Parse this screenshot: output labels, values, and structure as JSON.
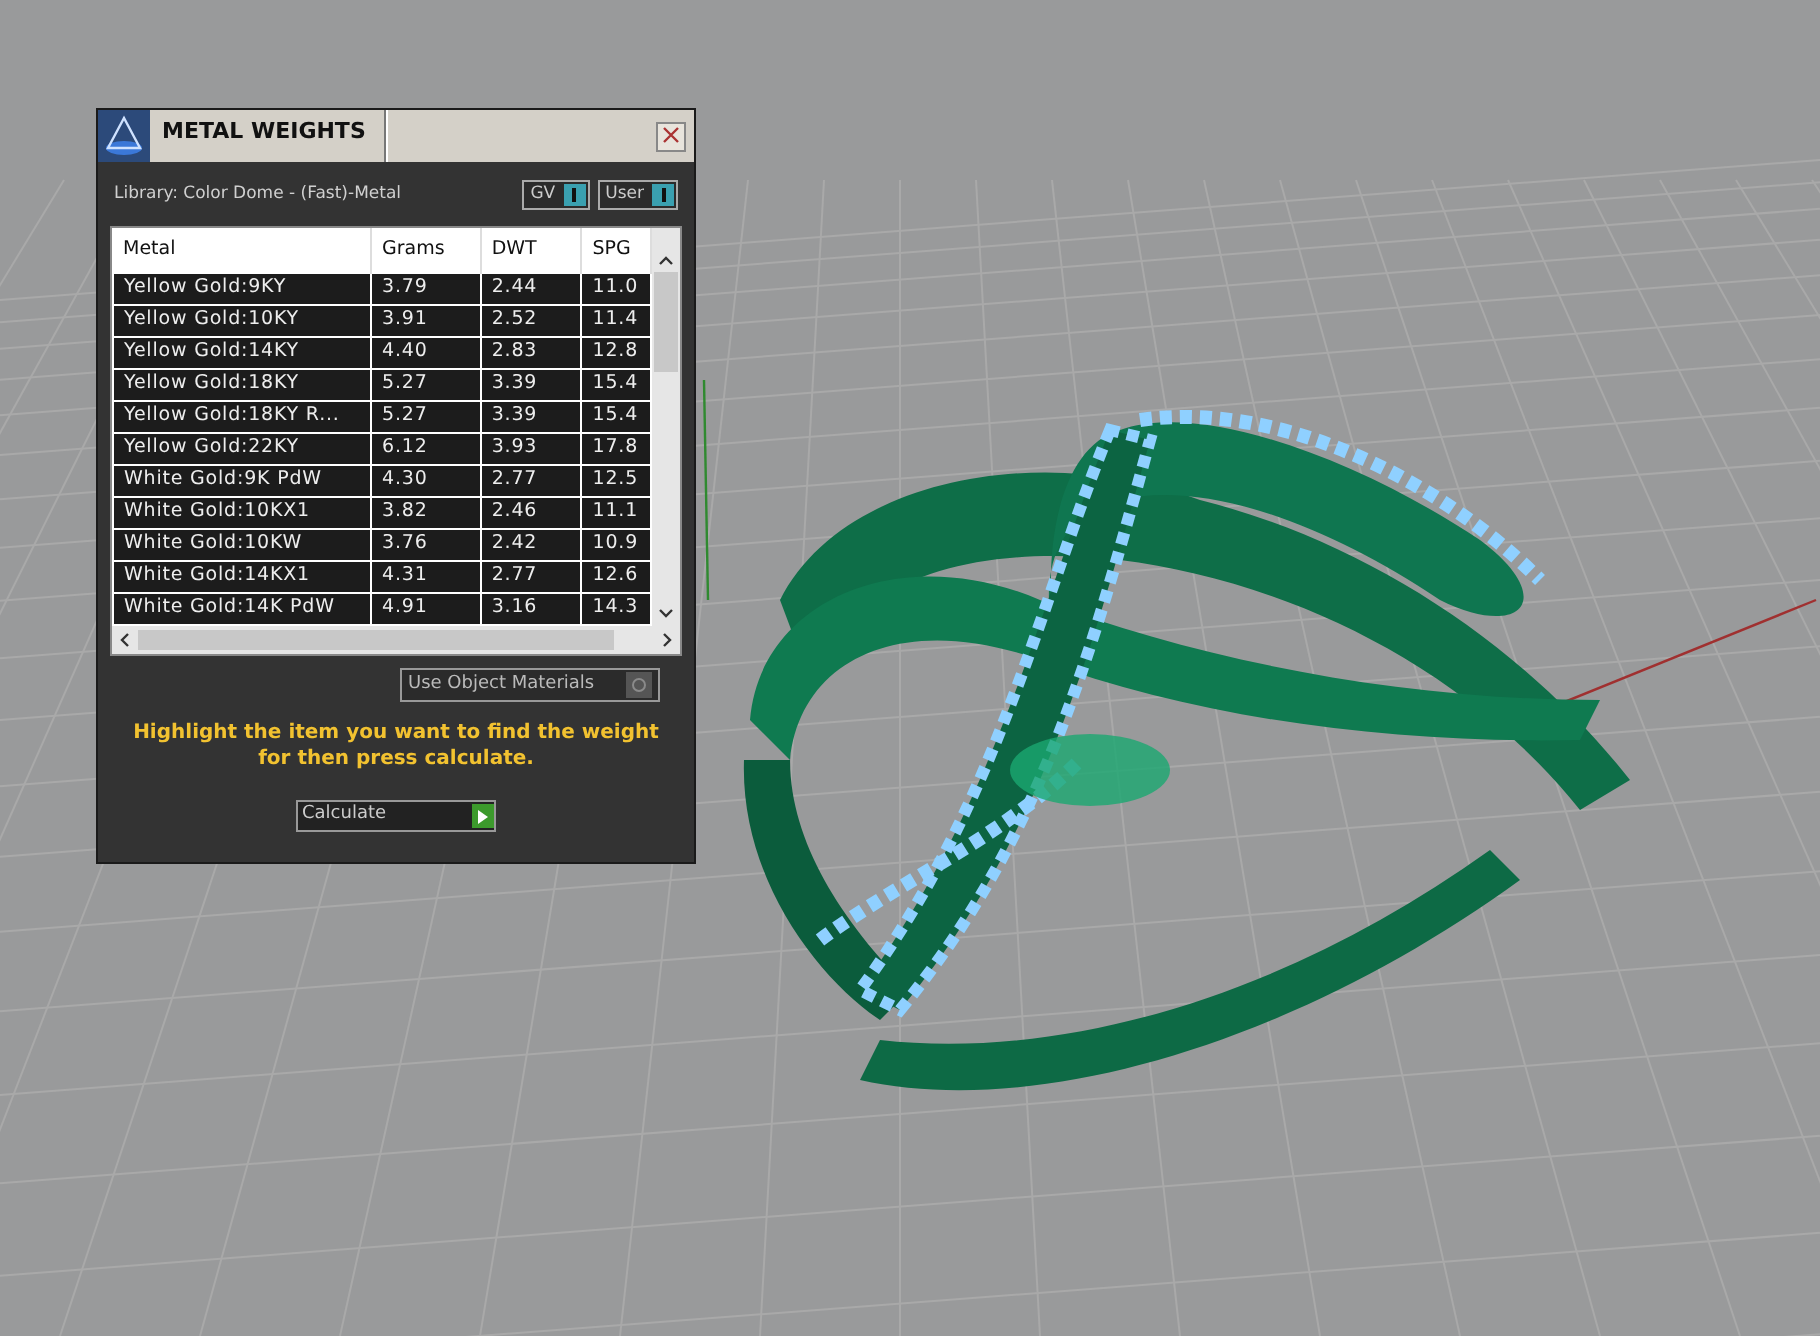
{
  "panel": {
    "title": "METAL WEIGHTS",
    "library": "Library: Color Dome - (Fast)-Metal",
    "toggles": [
      {
        "label": "GV",
        "on": true
      },
      {
        "label": "User",
        "on": true
      }
    ],
    "table": {
      "columns": [
        "Metal",
        "Grams",
        "DWT",
        "SPG"
      ],
      "rows": [
        {
          "cells": [
            "Yellow Gold:9KY",
            "3.79",
            "2.44",
            "11.0"
          ]
        },
        {
          "cells": [
            "Yellow Gold:10KY",
            "3.91",
            "2.52",
            "11.4"
          ]
        },
        {
          "cells": [
            "Yellow Gold:14KY",
            "4.40",
            "2.83",
            "12.8"
          ]
        },
        {
          "cells": [
            "Yellow Gold:18KY",
            "5.27",
            "3.39",
            "15.4"
          ]
        },
        {
          "cells": [
            "Yellow Gold:18KY R...",
            "5.27",
            "3.39",
            "15.4"
          ]
        },
        {
          "cells": [
            "Yellow Gold:22KY",
            "6.12",
            "3.93",
            "17.8"
          ]
        },
        {
          "cells": [
            "White Gold:9K PdW",
            "4.30",
            "2.77",
            "12.5"
          ]
        },
        {
          "cells": [
            "White Gold:10KX1",
            "3.82",
            "2.46",
            "11.1"
          ]
        },
        {
          "cells": [
            "White Gold:10KW",
            "3.76",
            "2.42",
            "10.9"
          ]
        },
        {
          "cells": [
            "White Gold:14KX1",
            "4.31",
            "2.77",
            "12.6"
          ]
        },
        {
          "cells": [
            "White Gold:14K PdW",
            "4.91",
            "3.16",
            "14.3"
          ]
        }
      ]
    },
    "use_object_materials": {
      "label": "Use Object Materials",
      "checked": false
    },
    "instruction": "Highlight the item you want to find the weight for then press calculate.",
    "calculate_button": "Calculate"
  }
}
